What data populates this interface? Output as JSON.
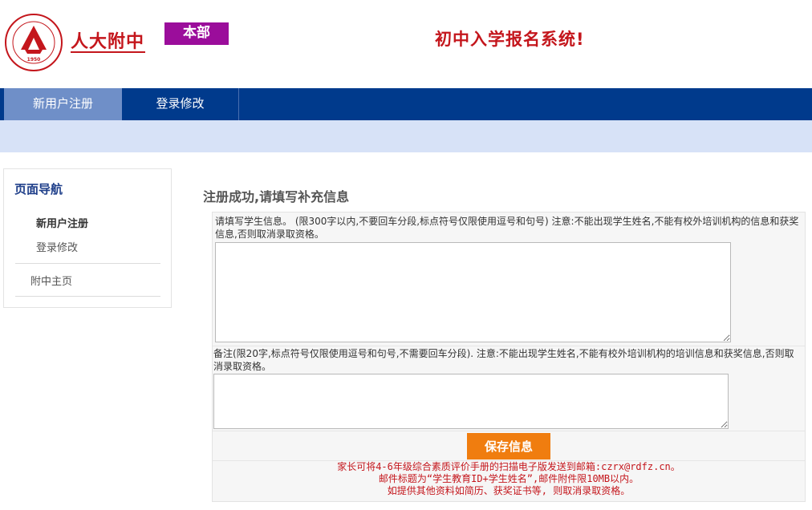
{
  "header": {
    "logo_seal_year": "1950",
    "school_name": "人大附中",
    "campus_badge": "本部",
    "system_title": "初中入学报名系统!"
  },
  "nav": {
    "tabs": [
      {
        "label": "新用户注册",
        "active": true
      },
      {
        "label": "登录修改",
        "active": false
      }
    ]
  },
  "sidebar": {
    "title": "页面导航",
    "items": [
      "新用户注册",
      "登录修改"
    ],
    "home_link": "附中主页"
  },
  "main": {
    "heading": "注册成功,请填写补充信息",
    "info_label": "请填写学生信息。 (限300字以内,不要回车分段,标点符号仅限使用逗号和句号) 注意:不能出现学生姓名,不能有校外培训机构的信息和获奖信息,否则取消录取资格。",
    "info_value": "",
    "remark_label": "备注(限20字,标点符号仅限使用逗号和句号,不需要回车分段). 注意:不能出现学生姓名,不能有校外培训机构的培训信息和获奖信息,否则取消录取资格。",
    "remark_value": "",
    "save_button": "保存信息",
    "notes": [
      "家长可将4-6年级综合素质评价手册的扫描电子版发送到邮箱:czrx@rdfz.cn。",
      "邮件标题为“学生教育ID+学生姓名”,邮件附件限10MB以内。",
      "如提供其他资料如简历、获奖证书等, 则取消录取资格。"
    ]
  },
  "colors": {
    "brand_red": "#c4161c",
    "nav_blue": "#003a8c",
    "nav_active": "#6f8fc8",
    "band": "#d7e2f7",
    "badge_purple": "#9b0d9b",
    "save_orange": "#f07d0f"
  },
  "icons": [
    "school-seal-logo"
  ]
}
